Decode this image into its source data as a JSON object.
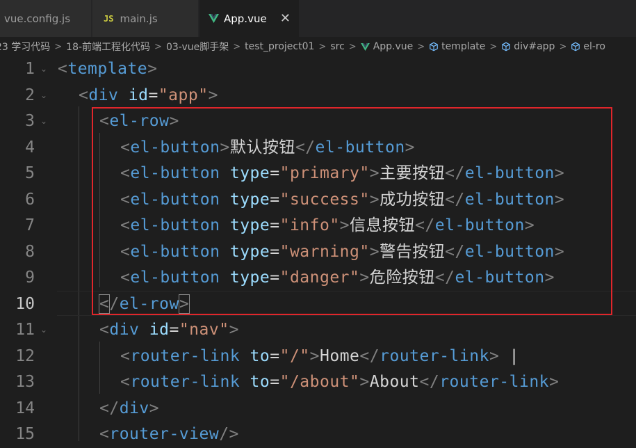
{
  "tabs": [
    {
      "label": "vue.config.js",
      "icon": "none"
    },
    {
      "label": "main.js",
      "icon": "js-icon"
    },
    {
      "label": "App.vue",
      "icon": "vue-icon",
      "active": true
    }
  ],
  "breadcrumb": [
    "23 学习代码",
    "18-前端工程化代码",
    "03-vue脚手架",
    "test_project01",
    "src",
    "App.vue",
    "template",
    "div#app",
    "el-ro"
  ],
  "editor": {
    "lines": [
      {
        "n": "1"
      },
      {
        "n": "2"
      },
      {
        "n": "3"
      },
      {
        "n": "4"
      },
      {
        "n": "5"
      },
      {
        "n": "6"
      },
      {
        "n": "7"
      },
      {
        "n": "8"
      },
      {
        "n": "9"
      },
      {
        "n": "10"
      },
      {
        "n": "11"
      },
      {
        "n": "12"
      },
      {
        "n": "13"
      },
      {
        "n": "14"
      },
      {
        "n": "15"
      }
    ],
    "active_line": "10",
    "tokens": {
      "template": "template",
      "div": "div",
      "id": "id",
      "app": "\"app\"",
      "el_row": "el-row",
      "el_button": "el-button",
      "type": "type",
      "primary": "\"primary\"",
      "success": "\"success\"",
      "info": "\"info\"",
      "warning": "\"warning\"",
      "danger": "\"danger\"",
      "btn_default": "默认按钮",
      "btn_primary": "主要按钮",
      "btn_success": "成功按钮",
      "btn_info": "信息按钮",
      "btn_warning": "警告按钮",
      "btn_danger": "危险按钮",
      "nav": "\"nav\"",
      "router_link": "router-link",
      "to": "to",
      "root_path": "\"/\"",
      "about_path": "\"/about\"",
      "home": "Home",
      "about": "About",
      "pipe": " |",
      "router_view": "router-view"
    }
  },
  "colors": {
    "tag": "#569cd6",
    "attr": "#9cdcfe",
    "string": "#ce9178",
    "highlight_box": "#e0262b"
  }
}
